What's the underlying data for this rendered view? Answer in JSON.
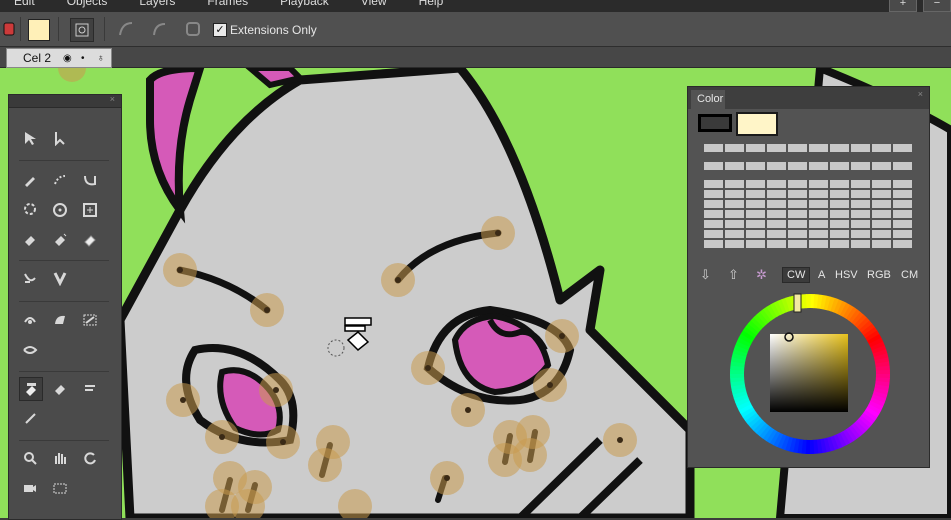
{
  "menubar": {
    "items": [
      "Edit",
      "Objects",
      "Layers",
      "Frames",
      "Playback",
      "View",
      "Help"
    ]
  },
  "toolbar": {
    "fill_color": "#fff0b8",
    "extensions_checkbox": {
      "checked": true,
      "label": "Extensions Only"
    }
  },
  "layerbar": {
    "cell_name": "Cel 2"
  },
  "canvas": {
    "background_color": "#90e05a",
    "character_color": "#cccccc",
    "accent_color": "#d55ab8",
    "control_point_color": "#c99a4e"
  },
  "color_panel": {
    "tab_label": "Color",
    "foreground_color": "#fff5c8",
    "modes": [
      "CW",
      "A",
      "HSV",
      "RGB",
      "CM"
    ],
    "selected_mode": "CW"
  }
}
